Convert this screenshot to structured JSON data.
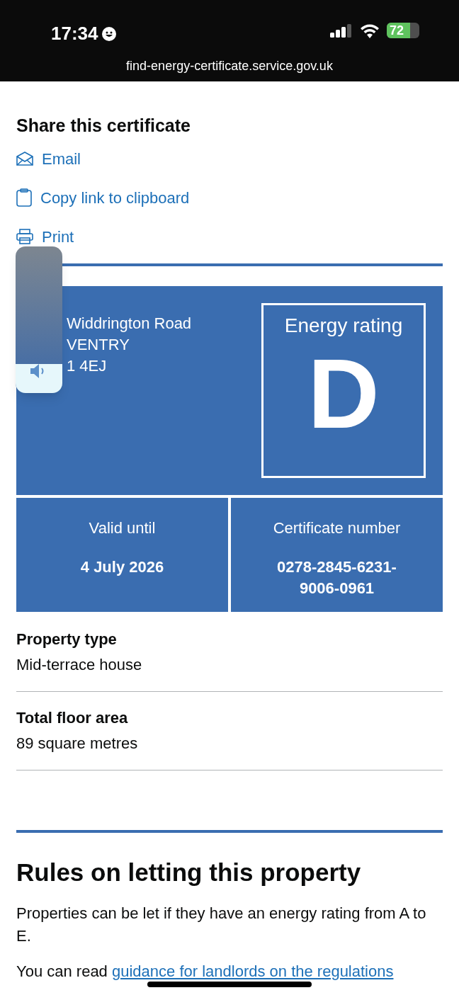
{
  "status_bar": {
    "time": "17:34",
    "battery": "72",
    "url": "find-energy-certificate.service.gov.uk"
  },
  "share": {
    "title": "Share this certificate",
    "links": [
      {
        "kind": "email",
        "label": "Email"
      },
      {
        "kind": "clipboard",
        "label": "Copy link to clipboard"
      },
      {
        "kind": "print",
        "label": "Print"
      }
    ]
  },
  "certificate": {
    "address": [
      "Widdrington Road",
      "VENTRY",
      "1 4EJ"
    ],
    "rating_label": "Energy rating",
    "rating": "D",
    "valid_label": "Valid until",
    "valid_value": "4 July 2026",
    "number_label": "Certificate number",
    "number_value": "0278-2845-6231-9006-0961"
  },
  "details": [
    {
      "label": "Property type",
      "value": "Mid-terrace house"
    },
    {
      "label": "Total floor area",
      "value": "89 square metres"
    }
  ],
  "letting": {
    "title": "Rules on letting this property",
    "paragraph": "Properties can be let if they have an energy rating from A to E.",
    "read_prefix": "You can read",
    "link": "guidance for landlords on the regulations"
  },
  "volume_hud": {
    "level": 0.2
  }
}
